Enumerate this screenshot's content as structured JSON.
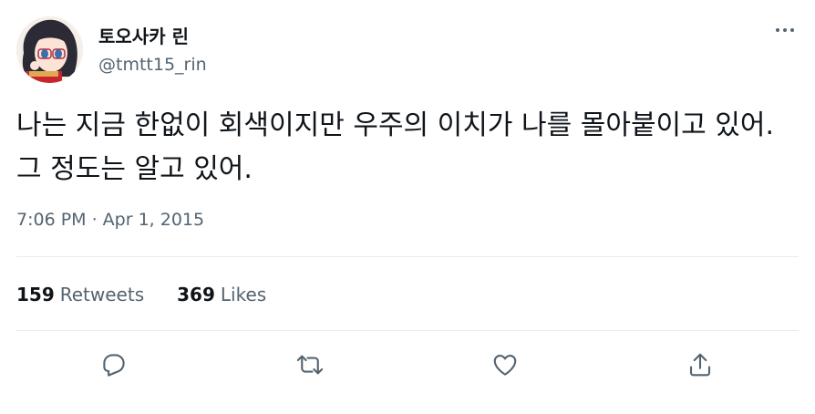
{
  "author": {
    "display_name": "토오사카 린",
    "handle": "@tmtt15_rin",
    "avatar_icon": "avatar-anime-girl"
  },
  "tweet": {
    "text": "나는 지금 한없이 회색이지만 우주의 이치가 나를 몰아붙이고 있어. 그 정도는 알고 있어.",
    "timestamp": "7:06 PM · Apr 1, 2015"
  },
  "stats": {
    "retweets_count": "159",
    "retweets_label": "Retweets",
    "likes_count": "369",
    "likes_label": "Likes"
  },
  "actions": {
    "reply_icon": "reply-icon",
    "retweet_icon": "retweet-icon",
    "like_icon": "heart-icon",
    "share_icon": "share-icon"
  },
  "colors": {
    "text_primary": "#0f1419",
    "text_secondary": "#536471",
    "divider": "#e6ecf0"
  }
}
